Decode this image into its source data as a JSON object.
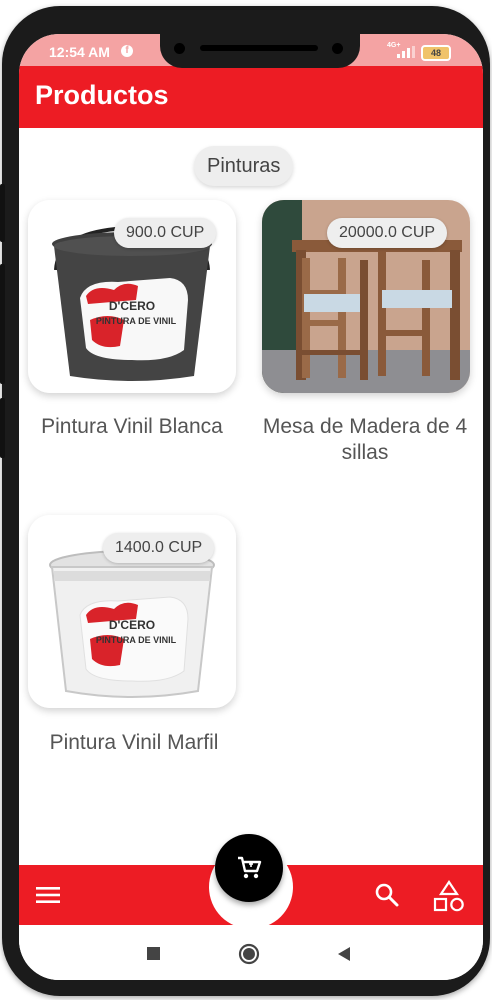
{
  "status_bar": {
    "time": "12:54 AM",
    "network": "4G+",
    "battery": "48"
  },
  "app_bar": {
    "title": "Productos"
  },
  "category_chip": {
    "label": "Pinturas"
  },
  "products": [
    {
      "name": "Pintura Vinil Blanca",
      "price": "900.0 CUP",
      "image": "gray-paint-bucket"
    },
    {
      "name": "Mesa de Madera de 4 sillas",
      "price": "20000.0 CUP",
      "image": "wooden-table-chairs"
    },
    {
      "name": "Pintura Vinil Marfil",
      "price": "1400.0 CUP",
      "image": "white-paint-bucket"
    }
  ],
  "paint_label": {
    "brand": "D'CERO",
    "product": "PINTURA DE VINIL"
  },
  "bottom_bar": {
    "fab_icon": "cart-icon",
    "left_icon": "menu-icon",
    "right_icons": [
      "search-icon",
      "categories-icon"
    ]
  },
  "nav_bar": {
    "icons": [
      "recents-icon",
      "home-icon",
      "back-icon"
    ]
  },
  "colors": {
    "brand_red": "#ed1c24",
    "status_bar": "#f4a3a3",
    "fab": "#000000",
    "chip_bg": "#eeeeee"
  }
}
